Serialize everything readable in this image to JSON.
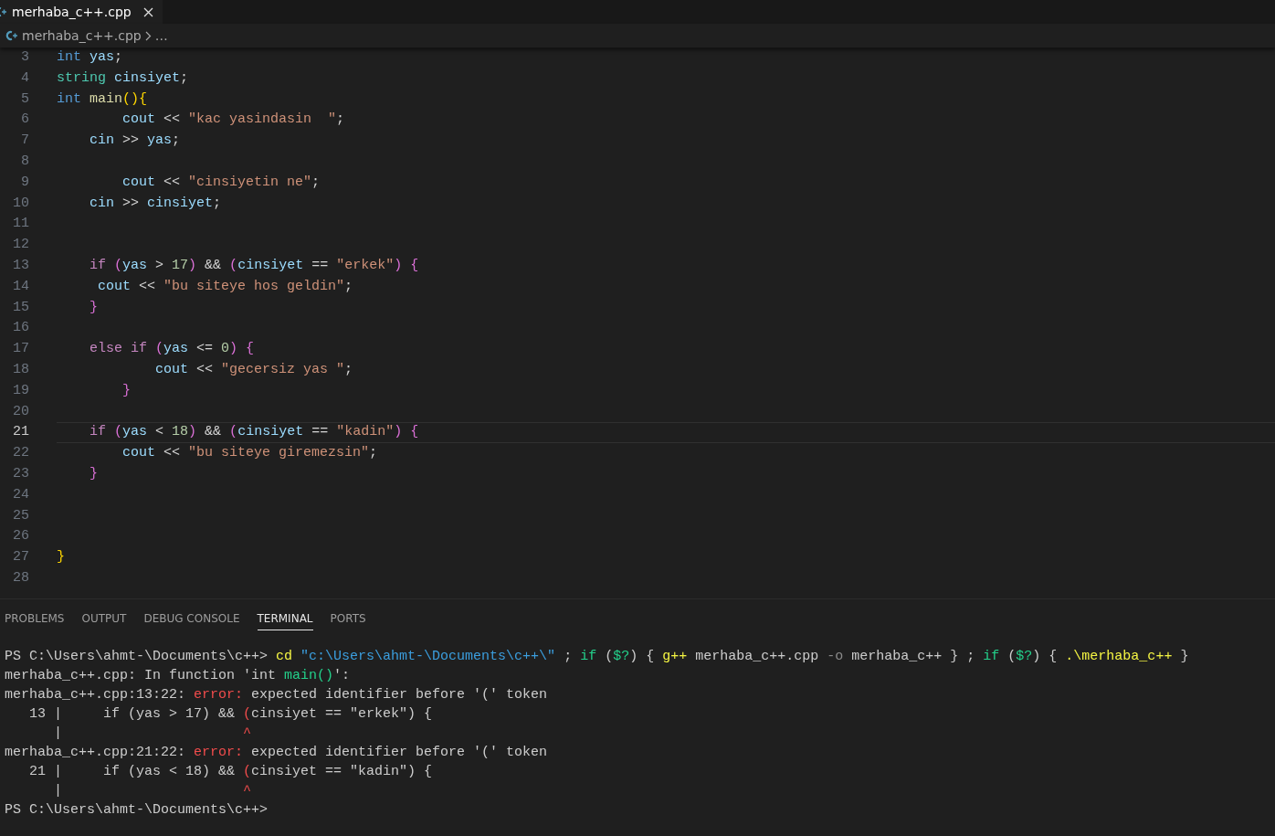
{
  "tab": {
    "label": "merhaba_c++.cpp",
    "selected": true
  },
  "breadcrumb": {
    "file": "merhaba_c++.cpp",
    "more": "…"
  },
  "editor": {
    "lines": [
      {
        "number": "3",
        "current": false,
        "tokens": [
          {
            "text": "int ",
            "kind": "keyword"
          },
          {
            "text": "yas",
            "kind": "variable"
          },
          {
            "text": ";",
            "kind": "plain"
          }
        ]
      },
      {
        "number": "4",
        "current": false,
        "tokens": [
          {
            "text": "string ",
            "kind": "type"
          },
          {
            "text": "cinsiyet",
            "kind": "variable"
          },
          {
            "text": ";",
            "kind": "plain"
          }
        ]
      },
      {
        "number": "5",
        "current": false,
        "tokens": [
          {
            "text": "int ",
            "kind": "keyword"
          },
          {
            "text": "main",
            "kind": "function"
          },
          {
            "text": "(){",
            "kind": "bracket1"
          }
        ]
      },
      {
        "number": "6",
        "current": false,
        "tokens": [
          {
            "text": "        cout",
            "kind": "variable"
          },
          {
            "text": " << ",
            "kind": "plain"
          },
          {
            "text": "\"kac yasindasin  \"",
            "kind": "string"
          },
          {
            "text": ";",
            "kind": "plain"
          }
        ]
      },
      {
        "number": "7",
        "current": false,
        "tokens": [
          {
            "text": "    cin",
            "kind": "variable"
          },
          {
            "text": " >> ",
            "kind": "plain"
          },
          {
            "text": "yas",
            "kind": "variable"
          },
          {
            "text": ";",
            "kind": "plain"
          }
        ]
      },
      {
        "number": "8",
        "current": false
      },
      {
        "number": "9",
        "current": false,
        "tokens": [
          {
            "text": "        cout",
            "kind": "variable"
          },
          {
            "text": " << ",
            "kind": "plain"
          },
          {
            "text": "\"cinsiyetin ne\"",
            "kind": "string"
          },
          {
            "text": ";",
            "kind": "plain"
          }
        ]
      },
      {
        "number": "10",
        "current": false,
        "tokens": [
          {
            "text": "    cin",
            "kind": "variable"
          },
          {
            "text": " >> ",
            "kind": "plain"
          },
          {
            "text": "cinsiyet",
            "kind": "variable"
          },
          {
            "text": ";",
            "kind": "plain"
          }
        ]
      },
      {
        "number": "11",
        "current": false
      },
      {
        "number": "12",
        "current": false
      },
      {
        "number": "13",
        "current": false,
        "tokens": [
          {
            "text": "    if ",
            "kind": "control"
          },
          {
            "text": "(",
            "kind": "bracket2"
          },
          {
            "text": "yas",
            "kind": "variable"
          },
          {
            "text": " > ",
            "kind": "plain"
          },
          {
            "text": "17",
            "kind": "number"
          },
          {
            "text": ")",
            "kind": "bracket2"
          },
          {
            "text": " && ",
            "kind": "plain"
          },
          {
            "text": "(",
            "kind": "bracket2"
          },
          {
            "text": "cinsiyet",
            "kind": "variable"
          },
          {
            "text": " == ",
            "kind": "plain"
          },
          {
            "text": "\"erkek\"",
            "kind": "string"
          },
          {
            "text": ") {",
            "kind": "bracket2"
          }
        ]
      },
      {
        "number": "14",
        "current": false,
        "tokens": [
          {
            "text": "     cout",
            "kind": "variable"
          },
          {
            "text": " << ",
            "kind": "plain"
          },
          {
            "text": "\"bu siteye hos geldin\"",
            "kind": "string"
          },
          {
            "text": ";",
            "kind": "plain"
          }
        ]
      },
      {
        "number": "15",
        "current": false,
        "tokens": [
          {
            "text": "    }",
            "kind": "bracket2"
          }
        ]
      },
      {
        "number": "16",
        "current": false
      },
      {
        "number": "17",
        "current": false,
        "tokens": [
          {
            "text": "    else if ",
            "kind": "control"
          },
          {
            "text": "(",
            "kind": "bracket2"
          },
          {
            "text": "yas",
            "kind": "variable"
          },
          {
            "text": " <= ",
            "kind": "plain"
          },
          {
            "text": "0",
            "kind": "number"
          },
          {
            "text": ") {",
            "kind": "bracket2"
          }
        ]
      },
      {
        "number": "18",
        "current": false,
        "tokens": [
          {
            "text": "            cout",
            "kind": "variable"
          },
          {
            "text": " << ",
            "kind": "plain"
          },
          {
            "text": "\"gecersiz yas \"",
            "kind": "string"
          },
          {
            "text": ";",
            "kind": "plain"
          }
        ]
      },
      {
        "number": "19",
        "current": false,
        "tokens": [
          {
            "text": "        }",
            "kind": "bracket2"
          }
        ]
      },
      {
        "number": "20",
        "current": false
      },
      {
        "number": "21",
        "current": true,
        "tokens": [
          {
            "text": "    if ",
            "kind": "control"
          },
          {
            "text": "(",
            "kind": "bracket2"
          },
          {
            "text": "yas",
            "kind": "variable"
          },
          {
            "text": " < ",
            "kind": "plain"
          },
          {
            "text": "18",
            "kind": "number"
          },
          {
            "text": ")",
            "kind": "bracket2"
          },
          {
            "text": " && ",
            "kind": "plain"
          },
          {
            "text": "(",
            "kind": "bracket2"
          },
          {
            "text": "cinsiyet",
            "kind": "variable"
          },
          {
            "text": " == ",
            "kind": "plain"
          },
          {
            "text": "\"kadin\"",
            "kind": "string"
          },
          {
            "text": ") {",
            "kind": "bracket2"
          }
        ]
      },
      {
        "number": "22",
        "current": false,
        "tokens": [
          {
            "text": "        cout",
            "kind": "variable"
          },
          {
            "text": " << ",
            "kind": "plain"
          },
          {
            "text": "\"bu siteye giremezsin\"",
            "kind": "string"
          },
          {
            "text": ";",
            "kind": "plain"
          }
        ]
      },
      {
        "number": "23",
        "current": false,
        "tokens": [
          {
            "text": "    }",
            "kind": "bracket2"
          }
        ]
      },
      {
        "number": "24",
        "current": false
      },
      {
        "number": "25",
        "current": false
      },
      {
        "number": "26",
        "current": false
      },
      {
        "number": "27",
        "current": false,
        "tokens": [
          {
            "text": "}",
            "kind": "bracket1"
          }
        ]
      },
      {
        "number": "28",
        "current": false
      }
    ]
  },
  "panel_tabs": [
    {
      "label": "PROBLEMS",
      "selected": false
    },
    {
      "label": "OUTPUT",
      "selected": false
    },
    {
      "label": "DEBUG CONSOLE",
      "selected": false
    },
    {
      "label": "TERMINAL",
      "selected": true
    },
    {
      "label": "PORTS",
      "selected": false
    }
  ],
  "terminal": {
    "lines": [
      [
        {
          "text": "PS C:\\Users\\ahmt-\\Documents\\c++> ",
          "kind": "plain"
        },
        {
          "text": "cd ",
          "kind": "command"
        },
        {
          "text": "\"c:\\Users\\ahmt-\\Documents\\c++\\\"",
          "kind": "string"
        },
        {
          "text": " ; ",
          "kind": "plain"
        },
        {
          "text": "if",
          "kind": "keyword"
        },
        {
          "text": " (",
          "kind": "plain"
        },
        {
          "text": "$?",
          "kind": "keyword"
        },
        {
          "text": ") { ",
          "kind": "plain"
        },
        {
          "text": "g++",
          "kind": "command"
        },
        {
          "text": " merhaba_c++.cpp ",
          "kind": "plain"
        },
        {
          "text": "-o",
          "kind": "dim"
        },
        {
          "text": " merhaba_c++ } ; ",
          "kind": "plain"
        },
        {
          "text": "if",
          "kind": "keyword"
        },
        {
          "text": " (",
          "kind": "plain"
        },
        {
          "text": "$?",
          "kind": "keyword"
        },
        {
          "text": ") { ",
          "kind": "plain"
        },
        {
          "text": ".\\merhaba_c++",
          "kind": "command"
        },
        {
          "text": " }",
          "kind": "plain"
        }
      ],
      [
        {
          "text": "merhaba_c++.cpp: In function 'int ",
          "kind": "plain"
        },
        {
          "text": "main()",
          "kind": "keyword"
        },
        {
          "text": "':",
          "kind": "plain"
        }
      ],
      [
        {
          "text": "merhaba_c++.cpp:13:22: ",
          "kind": "plain"
        },
        {
          "text": "error:",
          "kind": "error"
        },
        {
          "text": " expected identifier before '(' token",
          "kind": "plain"
        }
      ],
      [
        {
          "text": "   13 |     if (yas > 17) && ",
          "kind": "plain"
        },
        {
          "text": "(",
          "kind": "error"
        },
        {
          "text": "cinsiyet == \"erkek\") {",
          "kind": "plain"
        }
      ],
      [
        {
          "text": "      |                      ",
          "kind": "plain"
        },
        {
          "text": "^",
          "kind": "error"
        }
      ],
      [
        {
          "text": "merhaba_c++.cpp:21:22: ",
          "kind": "plain"
        },
        {
          "text": "error:",
          "kind": "error"
        },
        {
          "text": " expected identifier before '(' token",
          "kind": "plain"
        }
      ],
      [
        {
          "text": "   21 |     if (yas < 18) && ",
          "kind": "plain"
        },
        {
          "text": "(",
          "kind": "error"
        },
        {
          "text": "cinsiyet == \"kadin\") {",
          "kind": "plain"
        }
      ],
      [
        {
          "text": "      |                      ",
          "kind": "plain"
        },
        {
          "text": "^",
          "kind": "error"
        }
      ],
      [
        {
          "text": "PS C:\\Users\\ahmt-\\Documents\\c++>",
          "kind": "plain"
        }
      ]
    ]
  }
}
